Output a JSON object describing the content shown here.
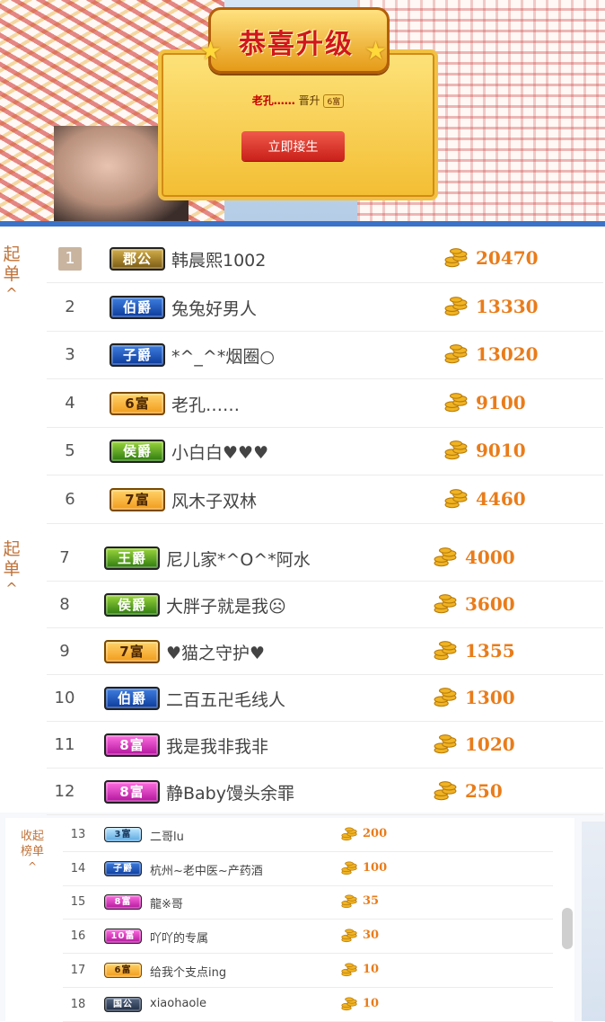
{
  "banner": {
    "title": "恭喜升级",
    "message_user": "老孔……",
    "message_verb": "晋升",
    "message_badge": "6富",
    "button_label": "立即接生"
  },
  "collapse_label_line1": "收起",
  "collapse_label_line2": "榜单",
  "collapse_caret": "^",
  "partial_collapse_line1": "起",
  "partial_collapse_line2": "单",
  "rows": [
    {
      "rank": "1",
      "badge": "郡公",
      "badge_color": "#7a5a13",
      "name": "韩晨熙1002",
      "amount": "20470"
    },
    {
      "rank": "2",
      "badge": "伯爵",
      "badge_color": "#0c3a9a",
      "name": "兔兔好男人",
      "amount": "13330"
    },
    {
      "rank": "3",
      "badge": "子爵",
      "badge_color": "#0c3a9a",
      "name": "*^_^*烟圈○",
      "amount": "13020"
    },
    {
      "rank": "4",
      "badge": "6富",
      "badge_color": "#f19b1b",
      "name": "老孔……",
      "amount": "9100"
    },
    {
      "rank": "5",
      "badge": "侯爵",
      "badge_color": "#2d7a10",
      "name": "小白白♥♥♥",
      "amount": "9010"
    },
    {
      "rank": "6",
      "badge": "7富",
      "badge_color": "#f19b1b",
      "name": "风木子双林",
      "amount": "4460"
    },
    {
      "rank": "7",
      "badge": "王爵",
      "badge_color": "#2d7a10",
      "name": "尼儿家*^O^*阿水",
      "amount": "4000"
    },
    {
      "rank": "8",
      "badge": "侯爵",
      "badge_color": "#2d7a10",
      "name": "大胖子就是我☹",
      "amount": "3600"
    },
    {
      "rank": "9",
      "badge": "7富",
      "badge_color": "#f19b1b",
      "name": "♥猫之守护♥",
      "amount": "1355"
    },
    {
      "rank": "10",
      "badge": "伯爵",
      "badge_color": "#0c3a9a",
      "name": "二百五卍毛线人",
      "amount": "1300"
    },
    {
      "rank": "11",
      "badge": "8富",
      "badge_color": "#b1159c",
      "name": "我是我非我非",
      "amount": "1020"
    },
    {
      "rank": "12",
      "badge": "8富",
      "badge_color": "#b1159c",
      "name": "静Baby馒头余罪",
      "amount": "250"
    },
    {
      "rank": "13",
      "badge": "3富",
      "badge_color": "#5aa7df",
      "name": "二哥lu",
      "amount": "200"
    },
    {
      "rank": "14",
      "badge": "子爵",
      "badge_color": "#0c3a9a",
      "name": "杭州~老中医~产药酒",
      "amount": "100"
    },
    {
      "rank": "15",
      "badge": "8富",
      "badge_color": "#b1159c",
      "name": "龍※哥",
      "amount": "35"
    },
    {
      "rank": "16",
      "badge": "10富",
      "badge_color": "#b1159c",
      "name": "吖吖的专属",
      "amount": "30"
    },
    {
      "rank": "17",
      "badge": "6富",
      "badge_color": "#f19b1b",
      "name": "给我个支点ing",
      "amount": "10"
    },
    {
      "rank": "18",
      "badge": "国公",
      "badge_color": "#1f2c44",
      "name": "xiaohaole",
      "amount": "10"
    }
  ]
}
